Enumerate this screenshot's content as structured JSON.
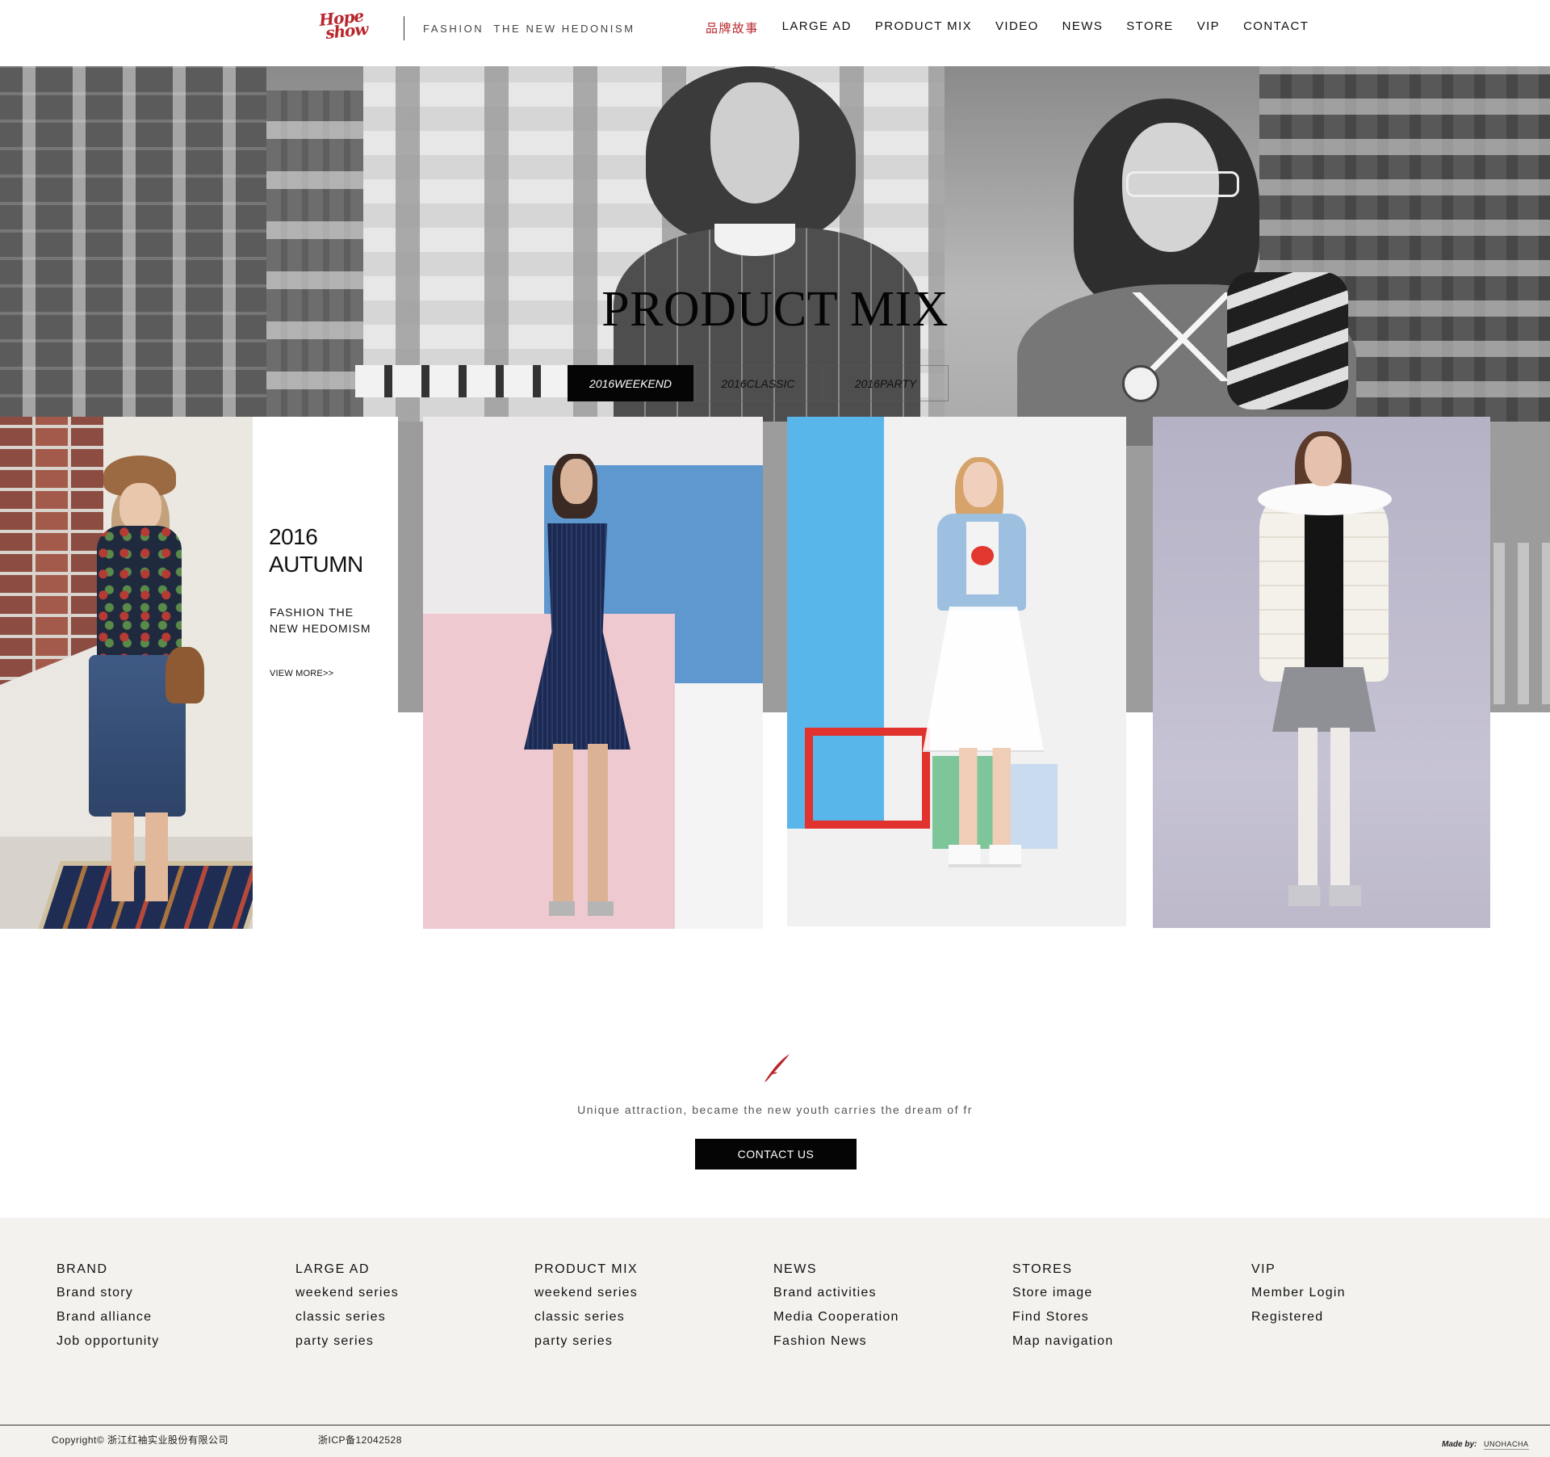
{
  "header": {
    "logo_line1": "Hope",
    "logo_line2": "show",
    "tagline": "FASHION  THE NEW HEDONISM",
    "nav": [
      {
        "label": "品牌故事",
        "active": true
      },
      {
        "label": "LARGE AD",
        "active": false
      },
      {
        "label": "PRODUCT MIX",
        "active": false
      },
      {
        "label": "VIDEO",
        "active": false
      },
      {
        "label": "NEWS",
        "active": false
      },
      {
        "label": "STORE",
        "active": false
      },
      {
        "label": "VIP",
        "active": false
      },
      {
        "label": "CONTACT",
        "active": false
      }
    ]
  },
  "hero": {
    "title": "PRODUCT MIX",
    "tabs": [
      {
        "label": "2016WEEKEND",
        "active": true
      },
      {
        "label": "2016CLASSIC",
        "active": false
      },
      {
        "label": "2016PARTY",
        "active": false
      }
    ]
  },
  "feature": {
    "year": "2016",
    "season": "AUTUMN",
    "subtitle_line1": "FASHION THE",
    "subtitle_line2": "NEW HEDOMISM",
    "view_more": "VIEW MORE>>"
  },
  "promo": {
    "slogan": "Unique attraction, became the new youth carries the dream of fr",
    "button": "CONTACT US"
  },
  "footer": {
    "columns": [
      {
        "title": "BRAND",
        "links": [
          "Brand story",
          "Brand alliance",
          "Job opportunity"
        ]
      },
      {
        "title": "LARGE AD",
        "links": [
          "weekend series",
          "classic series",
          "party series"
        ]
      },
      {
        "title": "PRODUCT MIX",
        "links": [
          "weekend series",
          "classic series",
          "party series"
        ]
      },
      {
        "title": "NEWS",
        "links": [
          "Brand activities",
          "Media Cooperation",
          "Fashion News"
        ]
      },
      {
        "title": "STORES",
        "links": [
          "Store image",
          "Find Stores",
          "Map navigation"
        ]
      },
      {
        "title": "VIP",
        "links": [
          "Member Login",
          "Registered"
        ]
      }
    ],
    "copyright": "Copyright© 浙江红袖实业股份有限公司",
    "icp": "浙ICP备12042528",
    "made_by_label": "Made by:",
    "made_by_name": "UNOHACHA"
  },
  "colors": {
    "brand_red": "#b8262c",
    "button_black": "#050505",
    "footer_bg": "#f3f2ee"
  }
}
